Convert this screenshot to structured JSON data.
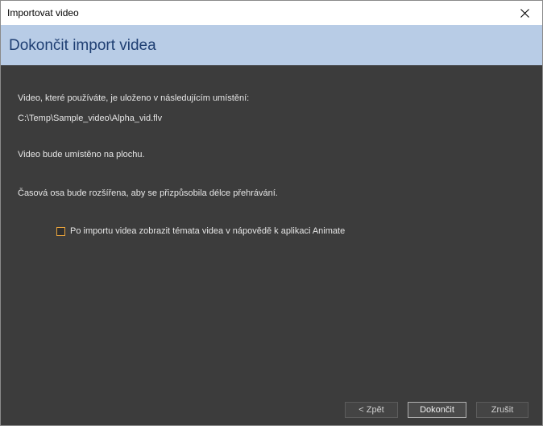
{
  "window": {
    "title": "Importovat video",
    "close_icon": "close-icon"
  },
  "header": {
    "title": "Dokončit import videa",
    "band_color": "#b8cce6",
    "title_color": "#1f3f73"
  },
  "content": {
    "location_label": "Video, které používáte, je uloženo v následujícím umístění:",
    "file_path": "C:\\Temp\\Sample_video\\Alpha_vid.flv",
    "placement_text": "Video bude umístěno na plochu.",
    "timeline_text": "Časová osa bude rozšířena, aby se přizpůsobila délce přehrávání.",
    "background_color": "#3c3c3c"
  },
  "checkbox": {
    "label": "Po importu videa zobrazit témata videa v nápovědě k aplikaci Animate",
    "checked": false,
    "border_color": "#e8a33c"
  },
  "buttons": {
    "back": "< Zpět",
    "finish": "Dokončit",
    "cancel": "Zrušit"
  }
}
